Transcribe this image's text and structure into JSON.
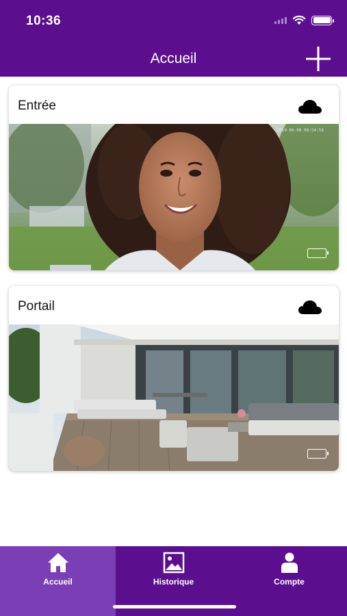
{
  "status_bar": {
    "time": "10:36"
  },
  "header": {
    "title": "Accueil"
  },
  "cameras": [
    {
      "name": "Entrée",
      "timestamp": "2019-06-08 08:54:58"
    },
    {
      "name": "Portail"
    }
  ],
  "tabs": [
    {
      "label": "Accueil",
      "icon": "home-icon",
      "active": true
    },
    {
      "label": "Historique",
      "icon": "image-icon",
      "active": false
    },
    {
      "label": "Compte",
      "icon": "user-icon",
      "active": false
    }
  ],
  "colors": {
    "primary": "#5b0f8e",
    "active_tab": "#7b3fb5"
  }
}
